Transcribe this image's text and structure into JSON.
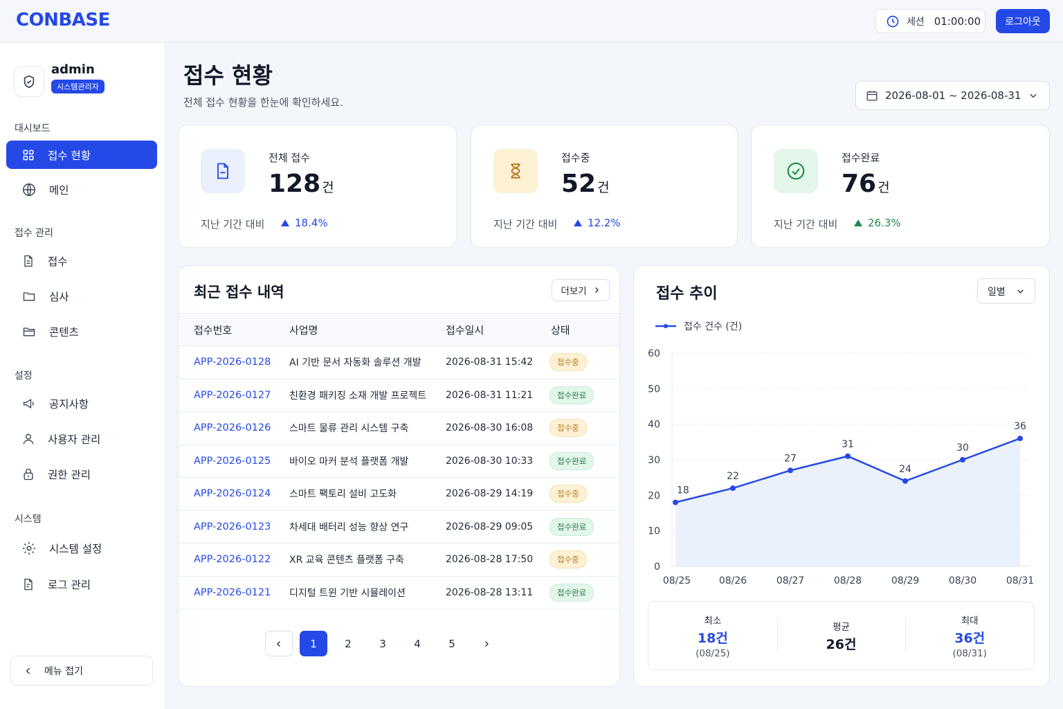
{
  "app": {
    "logo": "CONBASE"
  },
  "topbar": {
    "session_label": "세션",
    "session_time": "01:00:00",
    "logout_label": "로그아웃"
  },
  "profile": {
    "name": "admin",
    "role": "시스템관리자"
  },
  "sidebar": {
    "sections": [
      {
        "label": "대시보드",
        "items": [
          {
            "label": "접수 현황",
            "icon": "grid-icon",
            "active": true
          },
          {
            "label": "메인",
            "icon": "globe-icon"
          }
        ]
      },
      {
        "label": "접수 관리",
        "items": [
          {
            "label": "접수",
            "icon": "document-icon"
          },
          {
            "label": "심사",
            "icon": "folder-icon"
          },
          {
            "label": "콘텐츠",
            "icon": "folder-open-icon"
          }
        ]
      },
      {
        "label": "설정",
        "items": [
          {
            "label": "공지사항",
            "icon": "megaphone-icon"
          },
          {
            "label": "사용자 관리",
            "icon": "user-icon"
          },
          {
            "label": "권한 관리",
            "icon": "lock-icon"
          }
        ]
      },
      {
        "label": "시스템",
        "items": [
          {
            "label": "시스템 설정",
            "icon": "gear-icon"
          },
          {
            "label": "로그 관리",
            "icon": "log-icon"
          }
        ]
      }
    ],
    "collapse_label": "메뉴 접기"
  },
  "header": {
    "title": "접수 현황",
    "subtitle": "전체 접수 현황을 한눈에 확인하세요.",
    "date_range": "2026-08-01 ~ 2026-08-31"
  },
  "stats": [
    {
      "label": "전체 접수",
      "value": "128",
      "unit": "건",
      "compare_label": "지난 기간 대비",
      "change": "18.4%",
      "color": "#2549e6",
      "icon_bg": "#eaf0fd"
    },
    {
      "label": "접수중",
      "value": "52",
      "unit": "건",
      "compare_label": "지난 기간 대비",
      "change": "12.2%",
      "color": "#2549e6",
      "icon_bg": "#fdf1d4"
    },
    {
      "label": "접수완료",
      "value": "76",
      "unit": "건",
      "compare_label": "지난 기간 대비",
      "change": "26.3%",
      "color": "#1f8a4c",
      "icon_bg": "#e3f6ea"
    }
  ],
  "recent": {
    "title": "최근 접수 내역",
    "more_label": "더보기",
    "columns": [
      "접수번호",
      "사업명",
      "접수일시",
      "상태"
    ],
    "rows": [
      {
        "id": "APP-2026-0128",
        "name": "AI 기반 문서 자동화 솔루션 개발",
        "date": "2026-08-31 15:42",
        "status": "접수중",
        "kind": "progress"
      },
      {
        "id": "APP-2026-0127",
        "name": "친환경 패키징 소재 개발 프로젝트",
        "date": "2026-08-31 11:21",
        "status": "접수완료",
        "kind": "done"
      },
      {
        "id": "APP-2026-0126",
        "name": "스마트 물류 관리 시스템 구축",
        "date": "2026-08-30 16:08",
        "status": "접수중",
        "kind": "progress"
      },
      {
        "id": "APP-2026-0125",
        "name": "바이오 마커 분석 플랫폼 개발",
        "date": "2026-08-30 10:33",
        "status": "접수완료",
        "kind": "done"
      },
      {
        "id": "APP-2026-0124",
        "name": "스마트 팩토리 설비 고도화",
        "date": "2026-08-29 14:19",
        "status": "접수중",
        "kind": "progress"
      },
      {
        "id": "APP-2026-0123",
        "name": "차세대 배터리 성능 향상 연구",
        "date": "2026-08-29 09:05",
        "status": "접수완료",
        "kind": "done"
      },
      {
        "id": "APP-2026-0122",
        "name": "XR 교육 콘텐츠 플랫폼 구축",
        "date": "2026-08-28 17:50",
        "status": "접수중",
        "kind": "progress"
      },
      {
        "id": "APP-2026-0121",
        "name": "디지털 트윈 기반 시뮬레이션",
        "date": "2026-08-28 13:11",
        "status": "접수완료",
        "kind": "done"
      }
    ],
    "pages": [
      "1",
      "2",
      "3",
      "4",
      "5"
    ],
    "current_page": "1"
  },
  "trend": {
    "title": "접수 추이",
    "period": "일별",
    "summary": [
      {
        "label": "최소",
        "value": "18건",
        "date": "(08/25)",
        "color": "#2549e6"
      },
      {
        "label": "평균",
        "value": "26건",
        "date": "",
        "color": "#111827"
      },
      {
        "label": "최대",
        "value": "36건",
        "date": "(08/31)",
        "color": "#2549e6"
      }
    ]
  },
  "chart_data": {
    "type": "line",
    "title": "접수 추이",
    "x": [
      "08/25",
      "08/26",
      "08/27",
      "08/28",
      "08/29",
      "08/30",
      "08/31"
    ],
    "series": [
      {
        "name": "접수 건수 (건)",
        "values": [
          18,
          22,
          27,
          31,
          24,
          30,
          36
        ]
      }
    ],
    "ylim": [
      0,
      60
    ],
    "yticks": [
      0,
      10,
      20,
      30,
      40,
      50,
      60
    ],
    "grid": true,
    "legend": "top-left",
    "color": "#2549e6"
  }
}
